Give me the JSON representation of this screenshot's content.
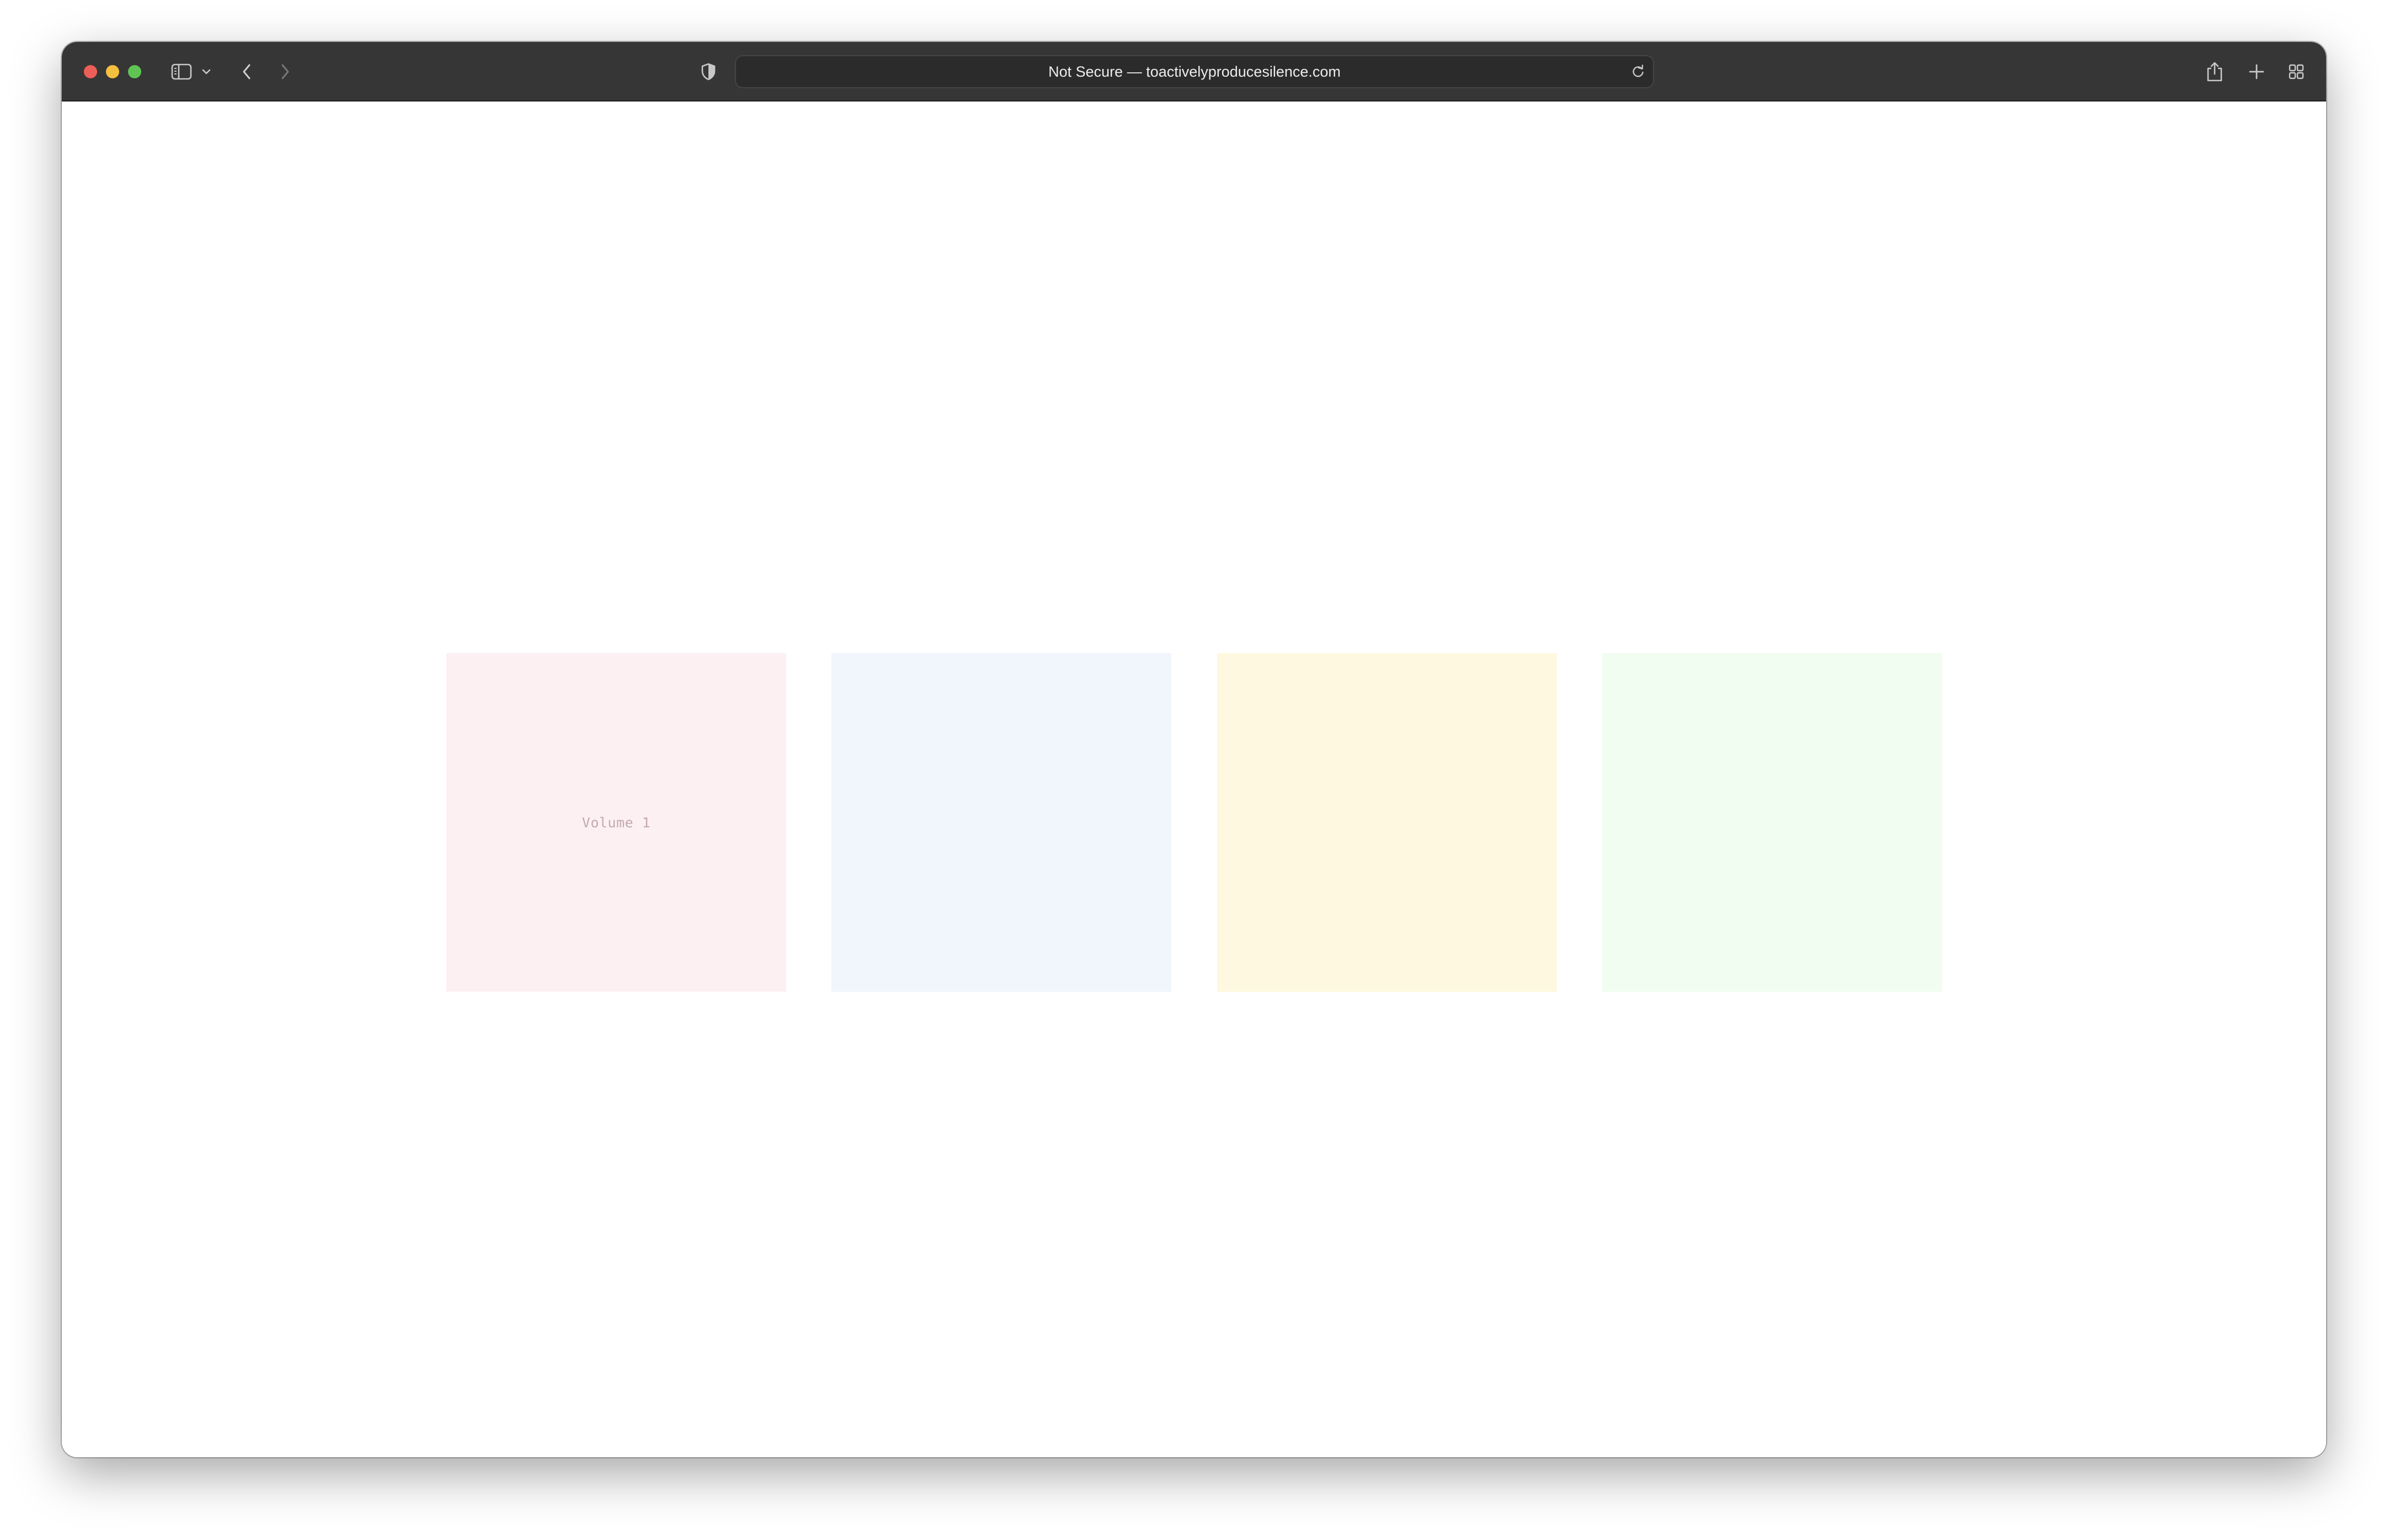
{
  "browser": {
    "address_bar": {
      "security": "Not Secure",
      "separator": " — ",
      "domain": "toactivelyproducesilence.com"
    },
    "icons": {
      "close": "close-dot",
      "minimize": "minimize-dot",
      "zoom": "zoom-dot",
      "sidebar": "sidebar-icon",
      "sidebar_menu": "chevron-down-icon",
      "back": "chevron-left-icon",
      "forward": "chevron-right-icon",
      "privacy": "shield-icon",
      "reload": "reload-icon",
      "share": "share-icon",
      "new_tab": "plus-icon",
      "tab_overview": "grid-icon"
    },
    "colors": {
      "close": "#ee5e58",
      "minimize": "#f5bf3f",
      "zoom": "#5fc454",
      "titlebar": "#363636"
    }
  },
  "page": {
    "tiles": [
      {
        "label": "Volume 1",
        "color": "#fcf0f3"
      },
      {
        "label": "",
        "color": "#f0f6fc"
      },
      {
        "label": "",
        "color": "#fef8e0"
      },
      {
        "label": "",
        "color": "#f1fdf0"
      }
    ]
  }
}
